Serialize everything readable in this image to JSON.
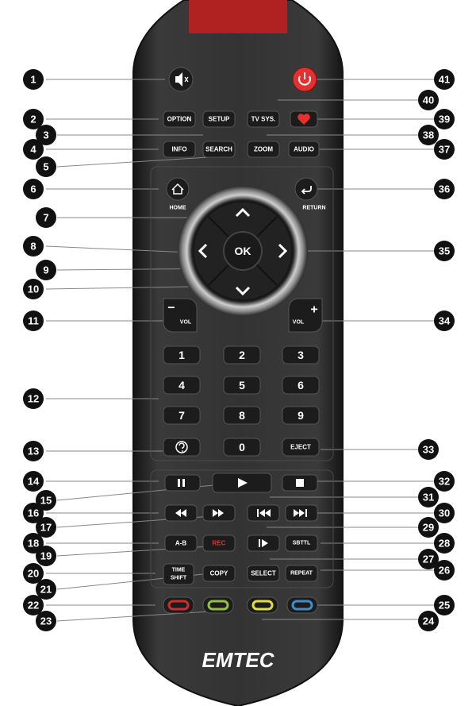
{
  "brand": "EMTEC",
  "buttons": {
    "option": "OPTION",
    "setup": "SETUP",
    "tvsys": "TV SYS.",
    "info": "INFO",
    "search": "SEARCH",
    "zoom": "ZOOM",
    "audio": "AUDIO",
    "home": "HOME",
    "return": "RETURN",
    "ok": "OK",
    "vol_minus": "VOL",
    "vol_plus": "VOL",
    "minus_sign": "−",
    "plus_sign": "+",
    "num1": "1",
    "num2": "2",
    "num3": "3",
    "num4": "4",
    "num5": "5",
    "num6": "6",
    "num7": "7",
    "num8": "8",
    "num9": "9",
    "num0": "0",
    "eject": "EJECT",
    "ab": "A-B",
    "rec": "REC",
    "subtitle": "SBTTL",
    "timeshift_line1": "TIME",
    "timeshift_line2": "SHIFT",
    "copy": "COPY",
    "select": "SELECT",
    "repeat": "REPEAT"
  },
  "callouts": [
    "1",
    "2",
    "3",
    "4",
    "5",
    "6",
    "7",
    "8",
    "9",
    "10",
    "11",
    "12",
    "13",
    "14",
    "15",
    "16",
    "17",
    "18",
    "19",
    "20",
    "21",
    "22",
    "23",
    "24",
    "25",
    "26",
    "27",
    "28",
    "29",
    "30",
    "31",
    "32",
    "33",
    "34",
    "35",
    "36",
    "37",
    "38",
    "39",
    "40",
    "41"
  ],
  "colors": {
    "body": "#2e2e2e",
    "body_edge": "#1a1a1a",
    "button": "#1c1c1c",
    "power": "#e53030",
    "heart": "#e53030",
    "top_strip": "#b32020",
    "key_red": "#d42a2a",
    "key_green": "#8fc43a",
    "key_yellow": "#e3df3a",
    "key_blue": "#3a8fd0",
    "rec_text": "#e53030"
  },
  "icons": [
    "mute-icon",
    "power-icon",
    "heart-icon",
    "home-icon",
    "return-icon",
    "up-arrow-icon",
    "down-arrow-icon",
    "left-arrow-icon",
    "right-arrow-icon",
    "help-icon",
    "pause-icon",
    "play-icon",
    "stop-icon",
    "rewind-icon",
    "fast-forward-icon",
    "previous-icon",
    "next-icon",
    "slow-icon"
  ]
}
